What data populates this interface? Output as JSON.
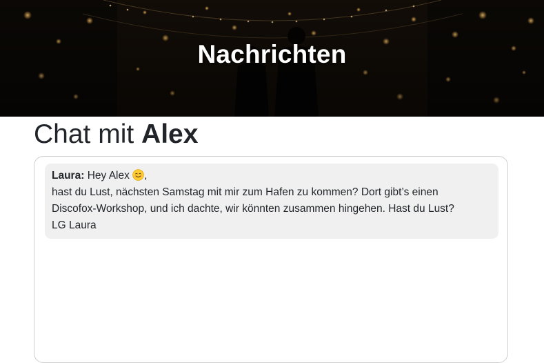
{
  "header": {
    "title": "Nachrichten"
  },
  "page": {
    "heading_prefix": "Chat mit",
    "heading_name": "Alex"
  },
  "messages": [
    {
      "sender": "Laura:",
      "greeting": "Hey Alex",
      "emoji": "smiling-face-icon",
      "greeting_suffix": ",",
      "line2": "hast du Lust, nächsten Samstag mit mir zum Hafen zu kommen? Dort gibt’s einen",
      "line3": "Discofox-Workshop, und ich dachte, wir könnten zusammen hingehen. Hast du Lust?",
      "signature": "LG Laura"
    }
  ]
}
